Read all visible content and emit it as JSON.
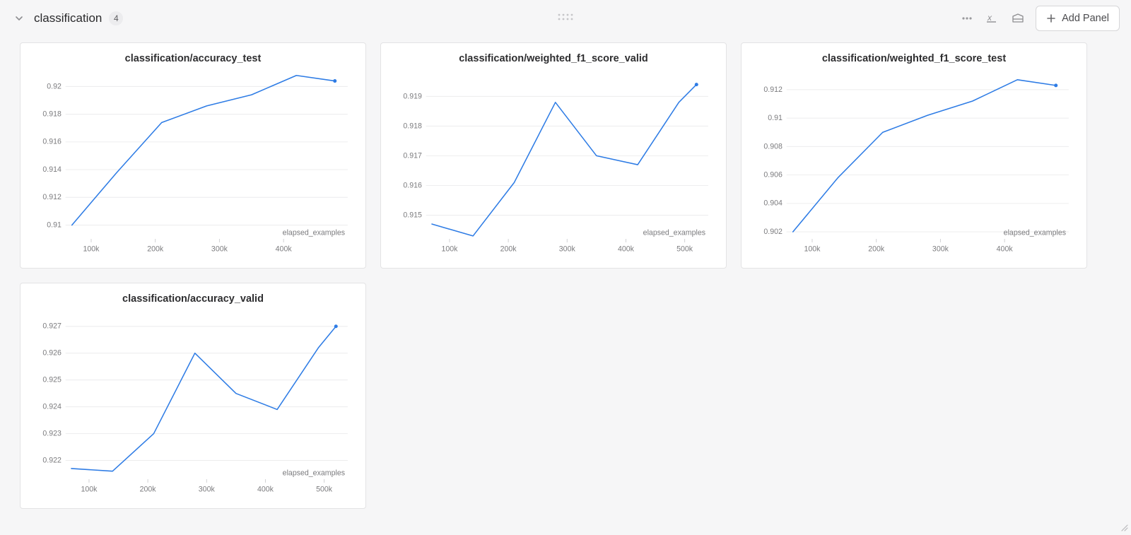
{
  "section": {
    "title": "classification",
    "count": "4",
    "add_panel_label": "Add Panel"
  },
  "x_axis_label": "elapsed_examples",
  "chart_data": [
    {
      "type": "line",
      "title": "classification/accuracy_test",
      "xlabel": "elapsed_examples",
      "ylabel": "",
      "x": [
        70000,
        140000,
        210000,
        280000,
        350000,
        420000,
        480000
      ],
      "y": [
        0.91,
        0.9138,
        0.9174,
        0.9186,
        0.9194,
        0.9208,
        0.9204
      ],
      "x_ticks": [
        100000,
        200000,
        300000,
        400000
      ],
      "x_tick_labels": [
        "100k",
        "200k",
        "300k",
        "400k"
      ],
      "y_ticks": [
        0.91,
        0.912,
        0.914,
        0.916,
        0.918,
        0.92
      ],
      "y_tick_labels": [
        "0.91",
        "0.912",
        "0.914",
        "0.916",
        "0.918",
        "0.92"
      ],
      "xlim": [
        60000,
        500000
      ],
      "ylim": [
        0.909,
        0.921
      ]
    },
    {
      "type": "line",
      "title": "classification/weighted_f1_score_valid",
      "xlabel": "elapsed_examples",
      "ylabel": "",
      "x": [
        70000,
        140000,
        210000,
        280000,
        350000,
        420000,
        490000,
        520000
      ],
      "y": [
        0.9147,
        0.9143,
        0.9161,
        0.9188,
        0.917,
        0.9167,
        0.9188,
        0.9194
      ],
      "x_ticks": [
        100000,
        200000,
        300000,
        400000,
        500000
      ],
      "x_tick_labels": [
        "100k",
        "200k",
        "300k",
        "400k",
        "500k"
      ],
      "y_ticks": [
        0.915,
        0.916,
        0.917,
        0.918,
        0.919
      ],
      "y_tick_labels": [
        "0.915",
        "0.916",
        "0.917",
        "0.918",
        "0.919"
      ],
      "xlim": [
        60000,
        540000
      ],
      "ylim": [
        0.9142,
        0.9198
      ]
    },
    {
      "type": "line",
      "title": "classification/weighted_f1_score_test",
      "xlabel": "elapsed_examples",
      "ylabel": "",
      "x": [
        70000,
        140000,
        210000,
        280000,
        350000,
        420000,
        480000
      ],
      "y": [
        0.902,
        0.9058,
        0.909,
        0.9102,
        0.9112,
        0.9127,
        0.9123
      ],
      "x_ticks": [
        100000,
        200000,
        300000,
        400000
      ],
      "x_tick_labels": [
        "100k",
        "200k",
        "300k",
        "400k"
      ],
      "y_ticks": [
        0.902,
        0.904,
        0.906,
        0.908,
        0.91,
        0.912
      ],
      "y_tick_labels": [
        "0.902",
        "0.904",
        "0.906",
        "0.908",
        "0.91",
        "0.912"
      ],
      "xlim": [
        60000,
        500000
      ],
      "ylim": [
        0.9015,
        0.9132
      ]
    },
    {
      "type": "line",
      "title": "classification/accuracy_valid",
      "xlabel": "elapsed_examples",
      "ylabel": "",
      "x": [
        70000,
        140000,
        210000,
        280000,
        350000,
        420000,
        490000,
        520000
      ],
      "y": [
        0.9217,
        0.9216,
        0.923,
        0.926,
        0.9245,
        0.9239,
        0.9262,
        0.927
      ],
      "x_ticks": [
        100000,
        200000,
        300000,
        400000,
        500000
      ],
      "x_tick_labels": [
        "100k",
        "200k",
        "300k",
        "400k",
        "500k"
      ],
      "y_ticks": [
        0.922,
        0.923,
        0.924,
        0.925,
        0.926,
        0.927
      ],
      "y_tick_labels": [
        "0.922",
        "0.923",
        "0.924",
        "0.925",
        "0.926",
        "0.927"
      ],
      "xlim": [
        60000,
        540000
      ],
      "ylim": [
        0.9213,
        0.9275
      ]
    }
  ]
}
